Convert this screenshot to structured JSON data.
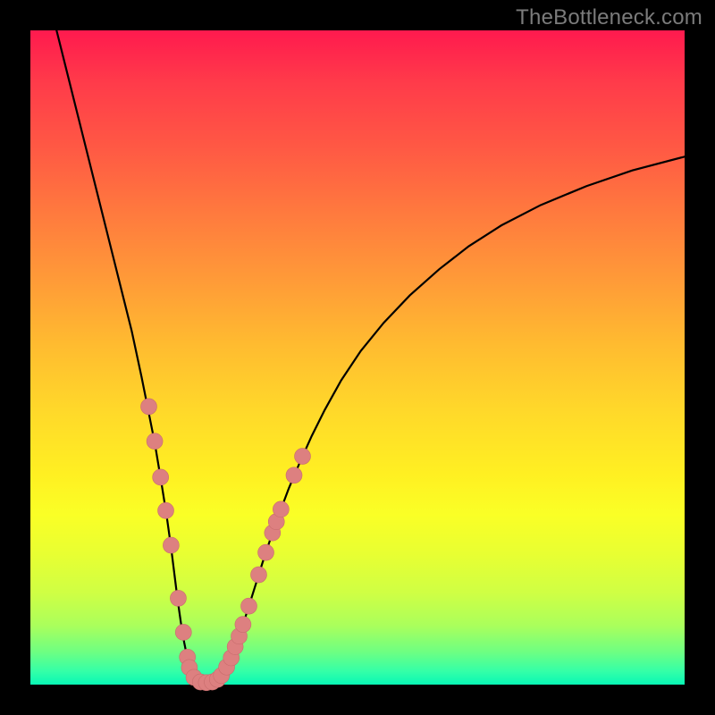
{
  "watermark_text": "TheBottleneck.com",
  "chart_data": {
    "type": "line",
    "title": "",
    "xlabel": "",
    "ylabel": "",
    "xlim": [
      0,
      100
    ],
    "ylim": [
      0,
      100
    ],
    "grid": false,
    "curve_points": [
      [
        4,
        100
      ],
      [
        6,
        92
      ],
      [
        8,
        84
      ],
      [
        10,
        76
      ],
      [
        12,
        68
      ],
      [
        14,
        60
      ],
      [
        15.5,
        54
      ],
      [
        17,
        47
      ],
      [
        18,
        42
      ],
      [
        19,
        37
      ],
      [
        20,
        31
      ],
      [
        20.8,
        26
      ],
      [
        21.5,
        21
      ],
      [
        22,
        17
      ],
      [
        22.5,
        13
      ],
      [
        23,
        9.5
      ],
      [
        23.5,
        6.5
      ],
      [
        24,
        4
      ],
      [
        24.7,
        2
      ],
      [
        25.5,
        0.8
      ],
      [
        26.5,
        0.3
      ],
      [
        27.5,
        0.3
      ],
      [
        28.5,
        0.7
      ],
      [
        29.3,
        1.6
      ],
      [
        30.2,
        3.2
      ],
      [
        31,
        5
      ],
      [
        31.8,
        7
      ],
      [
        32.6,
        9.5
      ],
      [
        33.4,
        12
      ],
      [
        34.5,
        15.5
      ],
      [
        35.5,
        18.7
      ],
      [
        36.6,
        22
      ],
      [
        38,
        26
      ],
      [
        39.5,
        30
      ],
      [
        41.2,
        34
      ],
      [
        43,
        38
      ],
      [
        45,
        42
      ],
      [
        47.5,
        46.5
      ],
      [
        50.5,
        51
      ],
      [
        54,
        55.3
      ],
      [
        58,
        59.5
      ],
      [
        62.5,
        63.5
      ],
      [
        67,
        67
      ],
      [
        72,
        70.2
      ],
      [
        78,
        73.3
      ],
      [
        85,
        76.2
      ],
      [
        92,
        78.6
      ],
      [
        100,
        80.7
      ]
    ],
    "markers": [
      [
        18.1,
        42.5
      ],
      [
        19.0,
        37.2
      ],
      [
        19.9,
        31.7
      ],
      [
        20.7,
        26.6
      ],
      [
        21.5,
        21.3
      ],
      [
        22.6,
        13.2
      ],
      [
        23.4,
        8.0
      ],
      [
        24.0,
        4.2
      ],
      [
        24.3,
        2.6
      ],
      [
        25.0,
        1.1
      ],
      [
        26.0,
        0.4
      ],
      [
        26.9,
        0.3
      ],
      [
        27.8,
        0.4
      ],
      [
        28.6,
        0.8
      ],
      [
        29.2,
        1.4
      ],
      [
        30.0,
        2.7
      ],
      [
        30.7,
        4.1
      ],
      [
        31.3,
        5.8
      ],
      [
        31.9,
        7.4
      ],
      [
        32.5,
        9.2
      ],
      [
        33.4,
        12.0
      ],
      [
        34.9,
        16.8
      ],
      [
        36.0,
        20.2
      ],
      [
        37.0,
        23.2
      ],
      [
        37.6,
        24.9
      ],
      [
        38.3,
        26.8
      ],
      [
        40.3,
        32.0
      ],
      [
        41.6,
        34.9
      ]
    ],
    "marker_radius": 9,
    "colors": {
      "curve": "#000000",
      "marker_fill": "#dd8080",
      "marker_stroke": "#c86d6d",
      "gradient_top": "#ff1a4e",
      "gradient_bottom": "#07f7b5",
      "frame": "#000000",
      "watermark": "#7b7b7b"
    }
  }
}
